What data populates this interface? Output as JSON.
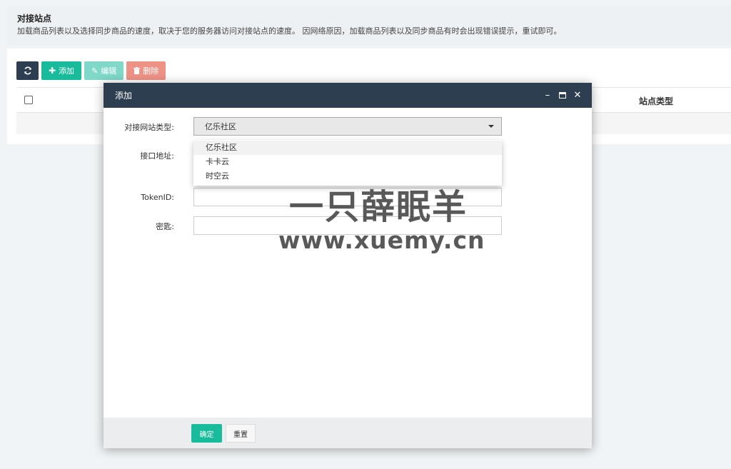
{
  "header": {
    "title": "对接站点",
    "description": "加载商品列表以及选择同步商品的速度，取决于您的服务器访问对接站点的速度。 因网络原因，加载商品列表以及同步商品有时会出现错误提示，重试即可。"
  },
  "toolbar": {
    "refresh_icon": "refresh-icon",
    "add_label": "添加",
    "edit_label": "编辑",
    "delete_label": "删除"
  },
  "table": {
    "columns": [
      "站点类型"
    ]
  },
  "modal": {
    "title": "添加",
    "form": {
      "site_type_label": "对接网站类型:",
      "site_type_value": "亿乐社区",
      "site_type_options": [
        "亿乐社区",
        "卡卡云",
        "时空云"
      ],
      "api_label": "接口地址:",
      "token_label": "TokenID:",
      "secret_label": "密匙:"
    },
    "footer": {
      "ok_label": "确定",
      "reset_label": "重置"
    }
  },
  "watermark": {
    "cn": "一只薛眠羊",
    "en": "www.xuemy.cn"
  },
  "colors": {
    "primary": "#18bc9c",
    "dark": "#2c3e50",
    "danger": "#ee9286",
    "edit": "#7fd8c8"
  }
}
